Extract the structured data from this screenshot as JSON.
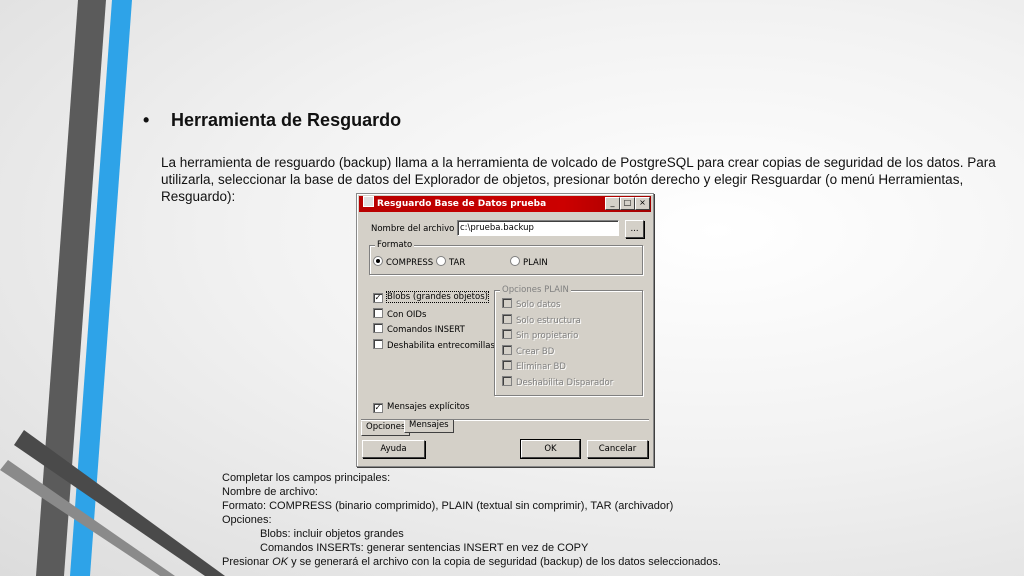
{
  "slide": {
    "heading": "Herramienta de Resguardo",
    "bullet": "•",
    "intro": "La herramienta de resguardo (backup) llama a la herramienta de volcado de PostgreSQL para crear copias de seguridad de los datos. Para utilizarla, seleccionar la base de datos del Explorador de objetos, presionar botón derecho y elegir Resguardar (o menú Herramientas, Resguardo):"
  },
  "dialog": {
    "title": "Resguardo Base de Datos prueba",
    "controls": [
      "_",
      "□",
      "×"
    ],
    "filename_label": "Nombre del archivo",
    "filename_value": "c:\\prueba.backup",
    "browse_label": "...",
    "format_group": "Formato",
    "format_options": [
      "COMPRESS",
      "TAR",
      "PLAIN"
    ],
    "format_selected": "COMPRESS",
    "options_left": [
      {
        "label": "Blobs (grandes objetos)",
        "checked": true
      },
      {
        "label": "Con OIDs",
        "checked": false
      },
      {
        "label": "Comandos INSERT",
        "checked": false
      },
      {
        "label": "Deshabilita entrecomillas",
        "checked": false
      }
    ],
    "plain_group": "Opciones PLAIN",
    "plain_options": [
      "Solo datos",
      "Solo estructura",
      "Sin propietario",
      "Crear BD",
      "Eliminar BD",
      "Deshabilita Disparador"
    ],
    "verbose_label": "Mensajes explícitos",
    "verbose_checked": true,
    "tabs": [
      "Opciones",
      "Mensajes"
    ],
    "help_button": "Ayuda",
    "ok_button": "OK",
    "cancel_button": "Cancelar"
  },
  "notes": {
    "line1": "Completar los campos principales:",
    "line2": "Nombre de archivo:",
    "line3": "Formato: COMPRESS (binario comprimido), PLAIN (textual sin comprimir), TAR (archivador)",
    "line4": "Opciones:",
    "line5": "Blobs: incluir objetos grandes",
    "line6": "Comandos INSERTs: generar sentencias INSERT en vez de COPY",
    "line7_pre": "Presionar ",
    "line7_ok": "OK",
    "line7_post": " y se generará el archivo con la copia de seguridad (backup) de los datos seleccionados."
  },
  "colors": {
    "accent_blue": "#2ea3e8",
    "deco_dark": "#5a5a5a",
    "title_red": "#c00000"
  }
}
